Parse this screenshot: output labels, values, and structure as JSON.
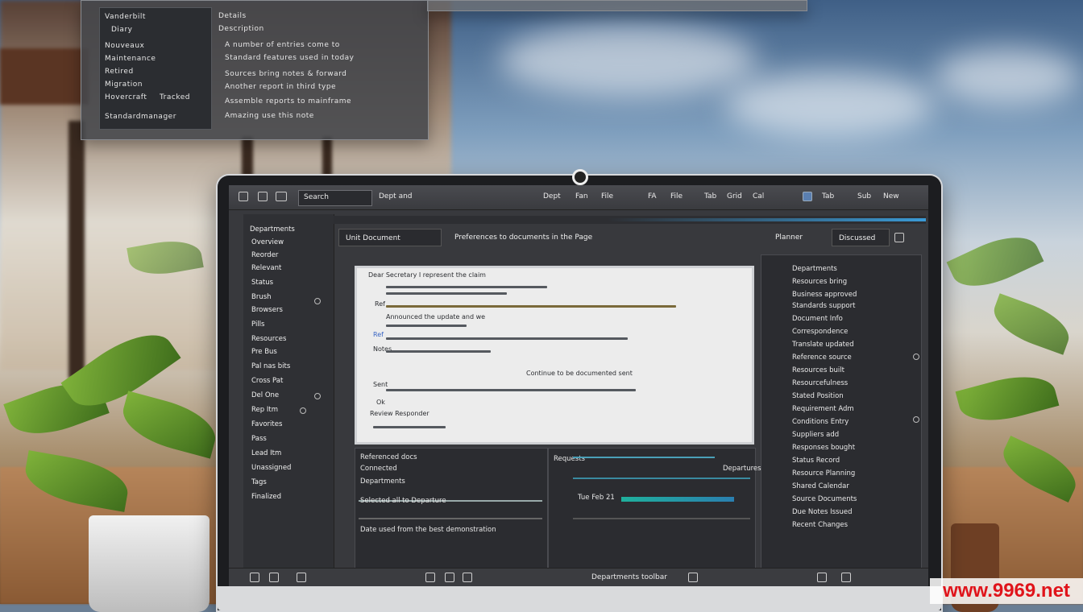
{
  "float_panel": {
    "left_rows": [
      "Vanderbilt",
      "Diary",
      "Nouveaux",
      "Maintenance",
      "Retired",
      "Migration",
      "Hovercraft",
      "Tracked",
      "Standardmanager"
    ],
    "right_rows": [
      "Details",
      "Description",
      "A number of entries come to",
      "Standard features used in today",
      "Sources bring notes & forward",
      "Another report in third type",
      "Assemble reports to mainframe",
      "Amazing use this note"
    ]
  },
  "toolbar": {
    "search_text": "Search",
    "center_text": "Dept and",
    "items": [
      "Dept",
      "Fan",
      "File",
      "FA",
      "File",
      "Tab",
      "Grid",
      "Cal",
      "Tab",
      "Sub",
      "New"
    ]
  },
  "tabs": [
    "Unit Document",
    "Preferences to documents in the Page",
    "Planner",
    "Discussed"
  ],
  "sidebar": {
    "items": [
      "Departments",
      "Overview",
      "Reorder",
      "Relevant",
      "Status",
      "Brush",
      "Browsers",
      "Pills",
      "Resources",
      "Pre Bus",
      "Pal nas bits",
      "Cross Pat",
      "Del One",
      "Rep Itm",
      "Favorites",
      "Pass",
      "Lead Itm",
      "Unassigned",
      "Tags",
      "Finalized"
    ]
  },
  "document": {
    "lines": [
      "Dear Secretary I represent the claim",
      "Ref",
      "Announced the update and we",
      "Ref",
      "Notes",
      "Continue to be documented sent",
      "Sent",
      "Ok",
      "Review Responder"
    ]
  },
  "right_panel": {
    "rows": [
      "Departments",
      "Resources bring",
      "Business approved",
      "Standards support",
      "Document Info",
      "Correspondence",
      "Translate updated",
      "Reference source",
      "Resources built",
      "Resourcefulness",
      "Stated Position",
      "Requirement Adm",
      "Conditions Entry",
      "Suppliers add",
      "Responses bought",
      "Status Record",
      "Resource Planning",
      "Shared Calendar",
      "Source Documents",
      "Due Notes Issued",
      "Recent Changes"
    ]
  },
  "bottom_left": {
    "rows": [
      "Referenced docs",
      "Connected",
      "Departments",
      "Selected all to Departure",
      "Date used from the best demonstration"
    ]
  },
  "bottom_mid": {
    "rows": [
      "Requests",
      "Departures",
      "Tue Feb 21"
    ]
  },
  "status_right": "Departments toolbar",
  "watermark": "www.9969.net"
}
